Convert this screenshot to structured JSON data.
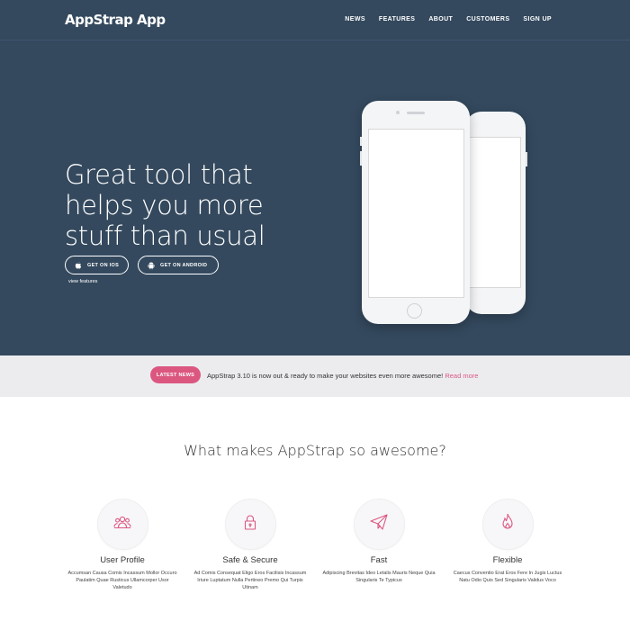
{
  "nav": {
    "brand": "AppStrap App",
    "links": [
      "NEWS",
      "FEATURES",
      "ABOUT",
      "CUSTOMERS",
      "SIGN UP"
    ]
  },
  "hero": {
    "title": "Great tool that helps you more stuff than usual",
    "ios_button": "GET ON IOS",
    "android_button": "GET ON ANDROID",
    "view_features": "view features"
  },
  "news": {
    "badge": "LATEST NEWS",
    "text": "AppStrap 3.10 is now out & ready to make your websites even more awesome!",
    "link": "Read more"
  },
  "features": {
    "title": "What makes AppStrap so awesome?",
    "items": [
      {
        "title": "User Profile",
        "desc": "Accumsan Causa Comis Incassum Mollor Occuro Paulatim Quae Rusticus Ullamcorper Usor Valetudo",
        "icon": "users-icon"
      },
      {
        "title": "Safe & Secure",
        "desc": "Ad Comis Consequat Eligo Eros Facilisis Incassum Iriure Luptatum Nulla Pertineo Premo Qui Turpis Utinam",
        "icon": "lock-icon"
      },
      {
        "title": "Fast",
        "desc": "Adipiscing Brevitas Ideo Letalis Mauris Neque Quia Singularis Te Typicus",
        "icon": "paper-plane-icon"
      },
      {
        "title": "Flexible",
        "desc": "Caecus Conventio Erat Eros Fere In Jugis Luctus Natu Odio Quis Sed Singularis Validus Voco",
        "icon": "flame-icon"
      }
    ]
  },
  "colors": {
    "hero_bg": "#34495e",
    "accent": "#dc5780",
    "news_bg": "#ececef"
  }
}
